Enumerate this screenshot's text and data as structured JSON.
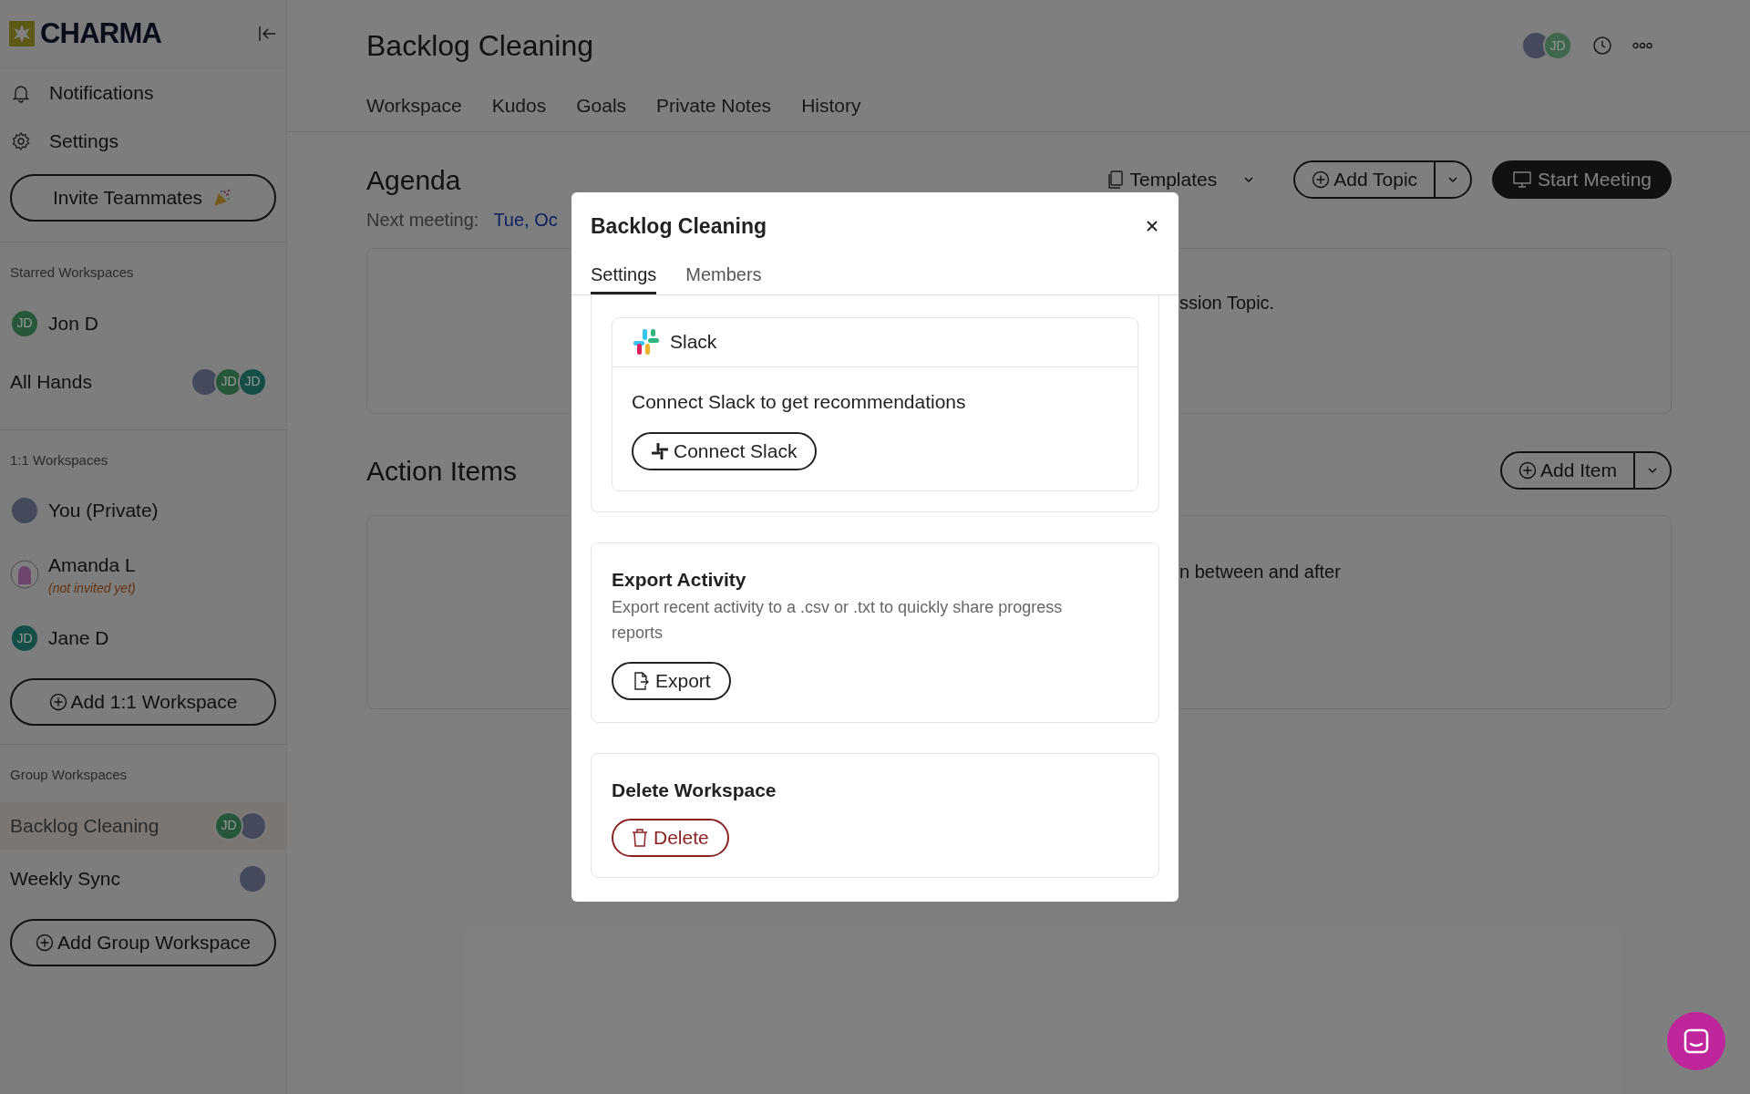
{
  "sidebar": {
    "logo": "CHARMA",
    "nav": [
      "Notifications",
      "Settings"
    ],
    "invite_button": "Invite Teammates",
    "sections": [
      {
        "heading": "Starred Workspaces",
        "items": [
          {
            "kind": "person",
            "label": "Jon D",
            "selected": false,
            "avatars": [
              {
                "kind": "initials",
                "text": "JD",
                "color": "#26573a"
              }
            ]
          },
          {
            "kind": "group",
            "label": "All Hands",
            "selected": false,
            "avatars": [
              {
                "kind": "photo"
              },
              {
                "kind": "initials",
                "text": "JD",
                "color": "#26573a"
              },
              {
                "kind": "initials",
                "text": "JD",
                "color": "#154e47"
              }
            ]
          }
        ]
      },
      {
        "heading": "1:1 Workspaces",
        "add_button": "Add 1:1 Workspace",
        "items": [
          {
            "kind": "person",
            "label": "You (Private)",
            "selected": false,
            "avatars": [
              {
                "kind": "photo"
              }
            ]
          },
          {
            "kind": "person",
            "label": "Amanda L",
            "note": "(not invited yet)",
            "selected": false,
            "avatars": [
              {
                "kind": "blob"
              }
            ]
          },
          {
            "kind": "person",
            "label": "Jane D",
            "selected": false,
            "avatars": [
              {
                "kind": "initials",
                "text": "JD",
                "color": "#154e47"
              }
            ]
          }
        ]
      },
      {
        "heading": "Group Workspaces",
        "add_button": "Add Group Workspace",
        "items": [
          {
            "kind": "group",
            "label": "Backlog Cleaning",
            "selected": true,
            "avatars": [
              {
                "kind": "initials",
                "text": "JD",
                "color": "#26573a"
              },
              {
                "kind": "photo"
              }
            ]
          },
          {
            "kind": "group",
            "label": "Weekly Sync",
            "selected": false,
            "avatars": [
              {
                "kind": "photo"
              }
            ]
          }
        ]
      }
    ]
  },
  "main": {
    "title": "Backlog Cleaning",
    "avatars": [
      {
        "kind": "photo"
      },
      {
        "kind": "initials",
        "text": "JD",
        "color": "#3f674d"
      }
    ],
    "tabs": [
      "Workspace",
      "Kudos",
      "Goals",
      "Private Notes",
      "History"
    ],
    "agenda": {
      "heading": "Agenda",
      "templates_button": "Templates",
      "add_topic_button": "Add Topic",
      "start_button": "Start Meeting",
      "next_label": "Next meeting:",
      "next_value": "Tue, Oc",
      "card_text": "ssion Topic."
    },
    "action_items": {
      "heading": "Action Items",
      "add_button": "Add Item",
      "card_text": "n between and after"
    }
  },
  "modal": {
    "title": "Backlog Cleaning",
    "tabs": [
      {
        "label": "Settings",
        "selected": true
      },
      {
        "label": "Members",
        "selected": false
      }
    ],
    "slack": {
      "name": "Slack",
      "description": "Connect Slack to get recommendations",
      "button": "Connect Slack"
    },
    "export": {
      "title": "Export Activity",
      "description": "Export recent activity to a .csv or .txt to quickly share progress reports",
      "button": "Export"
    },
    "delete": {
      "title": "Delete Workspace",
      "button": "Delete"
    }
  }
}
